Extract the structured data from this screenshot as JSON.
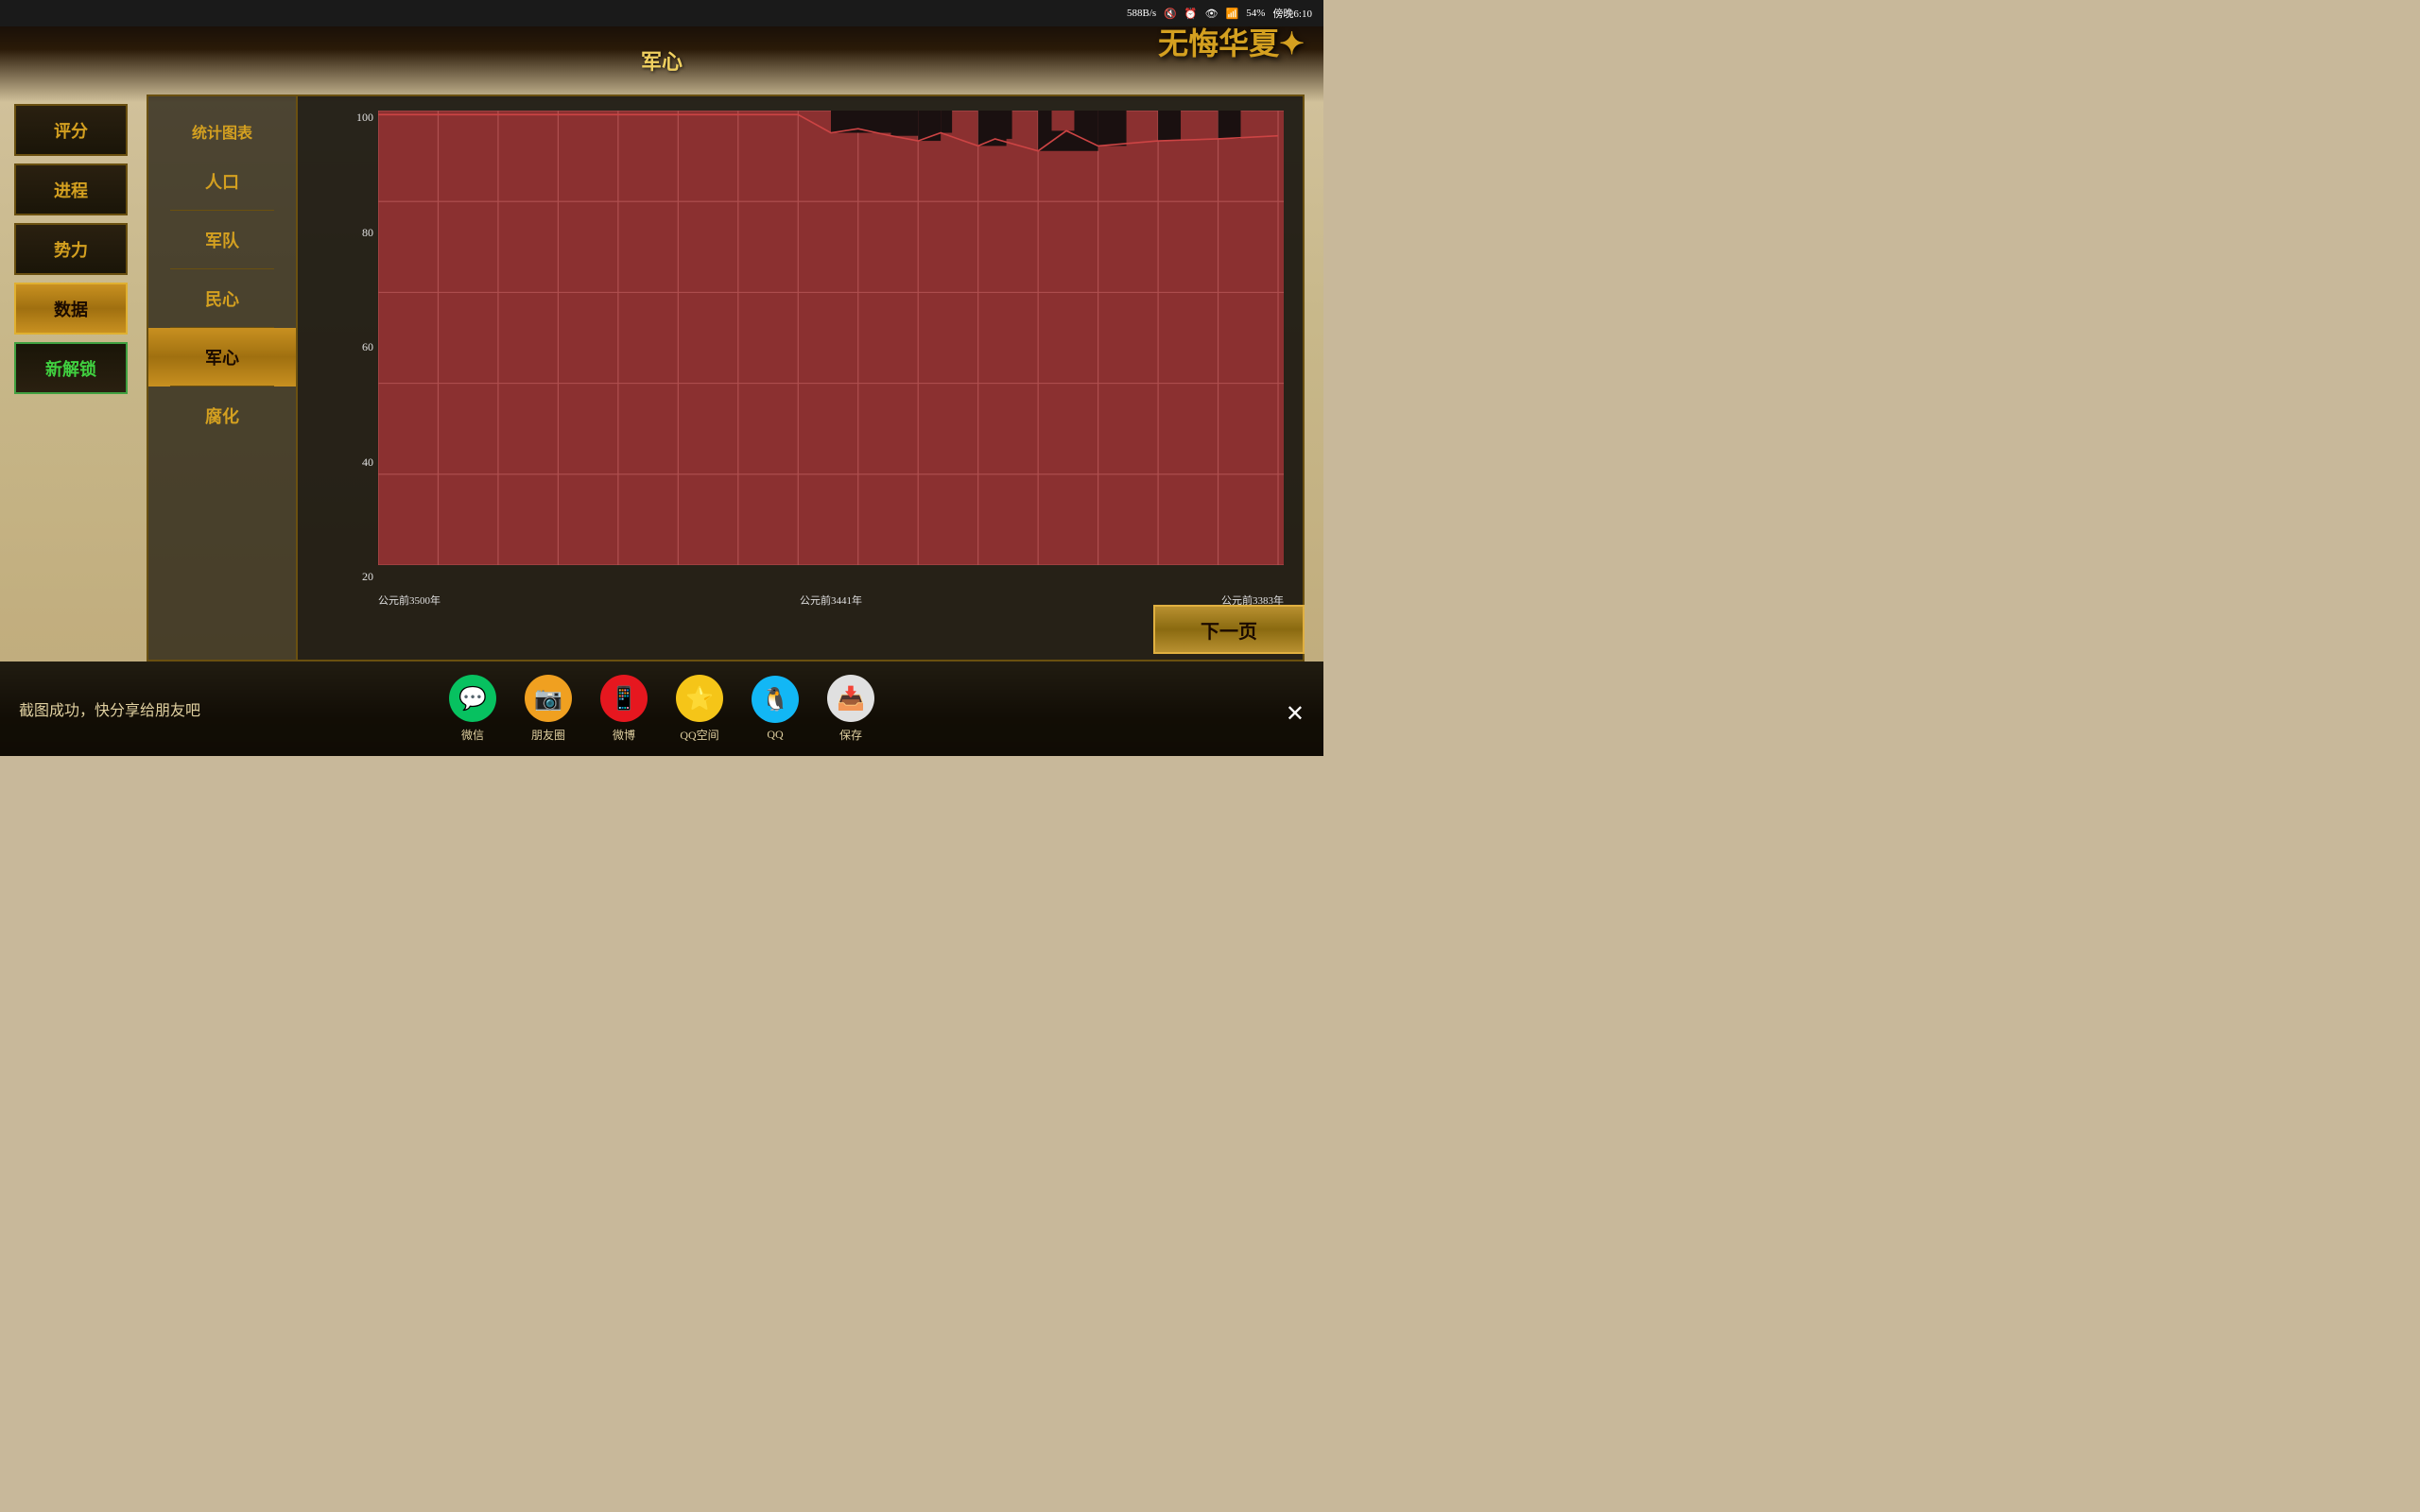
{
  "statusBar": {
    "network": "588B/s",
    "time": "傍晚6:10",
    "battery": "54%"
  },
  "gameLogo": "无悔华夏",
  "pageTitle": "军心",
  "leftNav": {
    "items": [
      {
        "label": "评分",
        "state": "normal"
      },
      {
        "label": "进程",
        "state": "normal"
      },
      {
        "label": "势力",
        "state": "normal"
      },
      {
        "label": "数据",
        "state": "active"
      },
      {
        "label": "新解锁",
        "state": "green"
      }
    ]
  },
  "subMenu": {
    "title": "统计图表",
    "items": [
      {
        "label": "人口",
        "active": false
      },
      {
        "label": "军队",
        "active": false
      },
      {
        "label": "民心",
        "active": false
      },
      {
        "label": "军心",
        "active": true
      },
      {
        "label": "腐化",
        "active": false
      }
    ]
  },
  "chart": {
    "yAxis": [
      "100",
      "80",
      "60",
      "40",
      "20"
    ],
    "xAxis": [
      "公元前3500年",
      "公元前3441年",
      "公元前3383年"
    ],
    "title": "军心"
  },
  "shareBar": {
    "text": "截图成功，快分享给朋友吧",
    "icons": [
      {
        "label": "微信",
        "emoji": "💬"
      },
      {
        "label": "朋友圈",
        "emoji": "📷"
      },
      {
        "label": "微博",
        "emoji": "📱"
      },
      {
        "label": "QQ空间",
        "emoji": "⭐"
      },
      {
        "label": "QQ",
        "emoji": "🐧"
      },
      {
        "label": "保存",
        "emoji": "📥"
      }
    ]
  },
  "nextButton": "下一页"
}
